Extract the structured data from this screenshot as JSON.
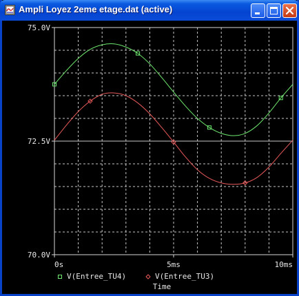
{
  "window": {
    "title": "Ampli Loyez 2eme etage.dat (active)",
    "buttons": {
      "minimize": "minimize-icon",
      "maximize": "maximize-icon",
      "close": "close-icon"
    }
  },
  "chart_data": {
    "type": "line",
    "xlabel": "Time",
    "ylabel": "",
    "xlim": [
      0,
      10
    ],
    "ylim": [
      70.0,
      75.0
    ],
    "x_ticks": [
      "0s",
      "5ms",
      "10ms"
    ],
    "y_ticks": [
      "70.0V",
      "72.5V",
      "75.0V"
    ],
    "grid": true,
    "legend": "bottom",
    "series": [
      {
        "name": "V(Entree_TU4)",
        "color": "#6ee86e",
        "marker": "square",
        "x": [
          0,
          0.5,
          1,
          1.5,
          2,
          2.5,
          3,
          3.5,
          4,
          4.5,
          5,
          5.5,
          6,
          6.5,
          7,
          7.5,
          8,
          8.5,
          9,
          9.5,
          10
        ],
        "y": [
          73.75,
          74.05,
          74.32,
          74.52,
          74.62,
          74.64,
          74.57,
          74.43,
          74.2,
          73.9,
          73.58,
          73.27,
          73.0,
          72.8,
          72.67,
          72.62,
          72.67,
          72.84,
          73.12,
          73.45,
          73.75
        ]
      },
      {
        "name": "V(Entree_TU3)",
        "color": "#e85a5a",
        "marker": "diamond",
        "x": [
          0,
          0.5,
          1,
          1.5,
          2,
          2.5,
          3,
          3.5,
          4,
          4.5,
          5,
          5.5,
          6,
          6.5,
          7,
          7.5,
          8,
          8.5,
          9,
          9.5,
          10
        ],
        "y": [
          72.52,
          72.85,
          73.15,
          73.38,
          73.53,
          73.56,
          73.5,
          73.34,
          73.1,
          72.8,
          72.48,
          72.15,
          71.87,
          71.68,
          71.58,
          71.55,
          71.58,
          71.7,
          71.93,
          72.23,
          72.52
        ]
      }
    ]
  }
}
